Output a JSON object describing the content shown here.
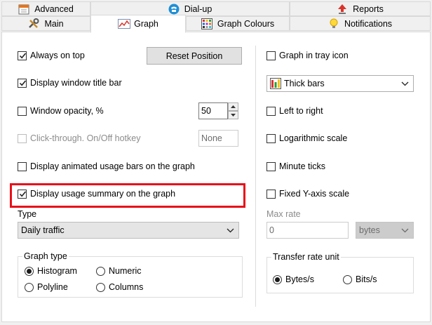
{
  "tabs_top": [
    {
      "label": "Advanced",
      "icon": "calendar-icon"
    },
    {
      "label": "Dial-up",
      "icon": "telephone-icon"
    },
    {
      "label": "Reports",
      "icon": "upload-arrow-icon"
    }
  ],
  "tabs_bottom": [
    {
      "label": "Main",
      "icon": "tools-icon"
    },
    {
      "label": "Graph",
      "icon": "graph-icon",
      "active": true
    },
    {
      "label": "Graph Colours",
      "icon": "palette-icon"
    },
    {
      "label": "Notifications",
      "icon": "lightbulb-icon"
    }
  ],
  "left": {
    "always_on_top": {
      "label": "Always on top",
      "checked": true
    },
    "reset_position": "Reset Position",
    "display_title_bar": {
      "label": "Display window title bar",
      "checked": true
    },
    "window_opacity": {
      "label": "Window opacity, %",
      "checked": false,
      "value": "50"
    },
    "click_through": {
      "label": "Click-through. On/Off hotkey",
      "checked": false,
      "hotkey": "None"
    },
    "animated_bars": {
      "label": "Display animated usage bars on the graph",
      "checked": false
    },
    "usage_summary": {
      "label": "Display usage summary on the graph",
      "checked": true
    },
    "type_label": "Type",
    "type_value": "Daily traffic",
    "graph_type": {
      "title": "Graph type",
      "options": [
        "Histogram",
        "Numeric",
        "Polyline",
        "Columns"
      ],
      "selected": "Histogram"
    }
  },
  "right": {
    "tray_icon": {
      "label": "Graph in tray icon",
      "checked": false
    },
    "bar_style": "Thick bars",
    "left_to_right": {
      "label": "Left to right",
      "checked": false
    },
    "log_scale": {
      "label": "Logarithmic scale",
      "checked": false
    },
    "minute_ticks": {
      "label": "Minute ticks",
      "checked": false
    },
    "fixed_y": {
      "label": "Fixed Y-axis scale",
      "checked": false
    },
    "max_rate_label": "Max rate",
    "max_rate_value": "0",
    "max_rate_unit": "bytes",
    "transfer_unit": {
      "title": "Transfer rate unit",
      "options": [
        "Bytes/s",
        "Bits/s"
      ],
      "selected": "Bytes/s"
    }
  },
  "colors": {
    "highlight": "#e8101a"
  }
}
